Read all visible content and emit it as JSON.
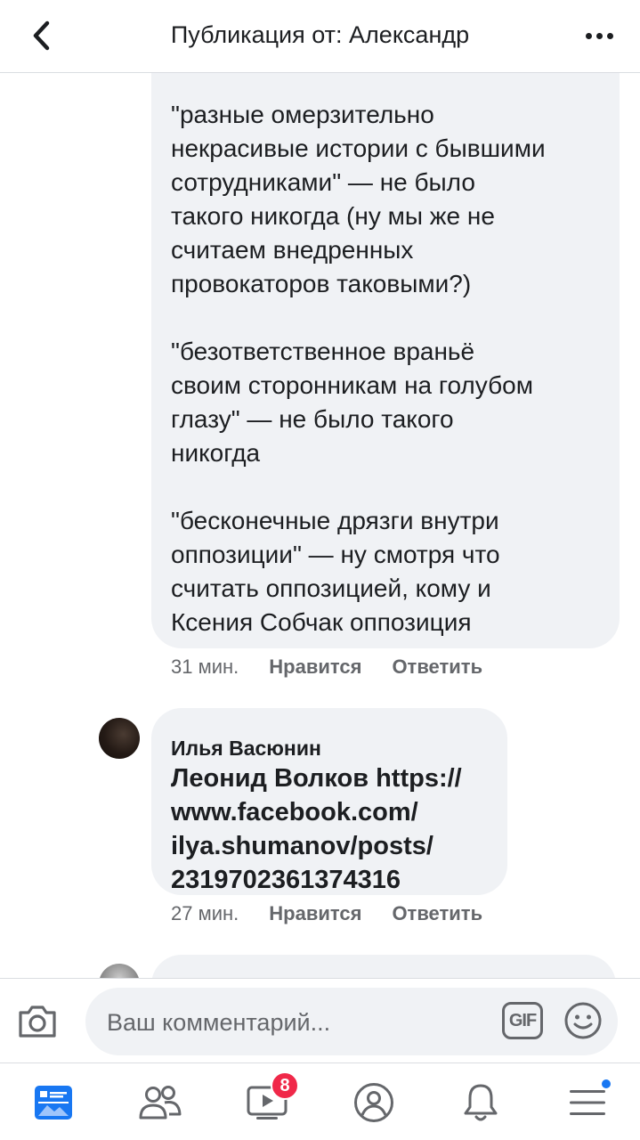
{
  "header": {
    "title": "Публикация от: Александр"
  },
  "comments": [
    {
      "paragraphs": [
        "\"разные омерзительно\nнекрасивые истории с бывшими\nсотрудниками\" — не было\nтакого никогда (ну мы же не\nсчитаем внедренных\nпровокаторов таковыми?)",
        "\"безответственное враньё\nсвоим сторонникам на голубом\nглазу\" — не было такого\nникогда",
        "\"бесконечные дрязги внутри\nоппозиции\" — ну смотря что\nсчитать оппозицией, кому и\nКсения Собчак оппозиция"
      ],
      "time": "31 мин.",
      "like_label": "Нравится",
      "reply_label": "Ответить"
    },
    {
      "author": "Илья Васюнин",
      "body": "Леонид Волков  https://\nwww.facebook.com/\nilya.shumanov/posts/\n2319702361374316",
      "time": "27 мин.",
      "like_label": "Нравится",
      "reply_label": "Ответить"
    }
  ],
  "composer": {
    "placeholder": "Ваш комментарий...",
    "gif_label": "GIF"
  },
  "bottom_nav": {
    "items": [
      "news-feed",
      "friends",
      "watch",
      "profile",
      "notifications",
      "menu"
    ],
    "watch_badge": "8",
    "active_item": "news-feed",
    "accent_color": "#1877f2",
    "badge_color": "#f02849"
  }
}
